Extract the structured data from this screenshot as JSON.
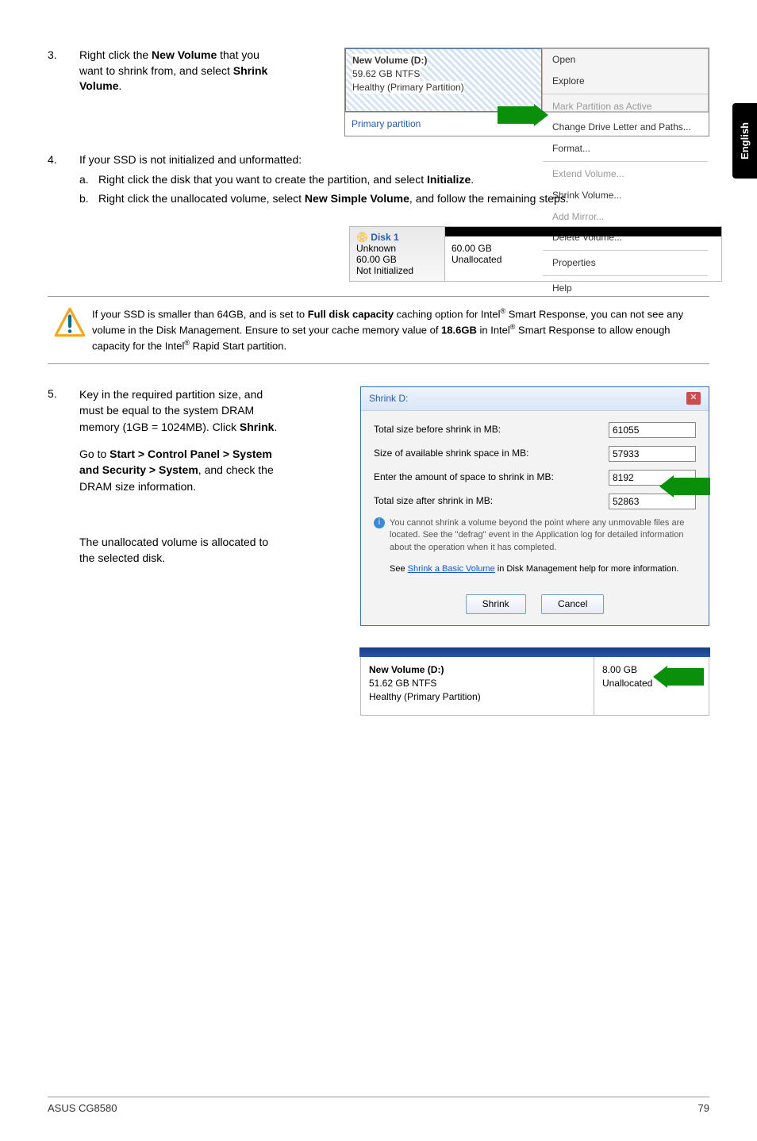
{
  "sidetab": "English",
  "step3": {
    "num": "3.",
    "t1": "Right click the ",
    "b1": "New Volume",
    "t2": " that you want to shrink from, and select ",
    "b2": "Shrink Volume",
    "t3": "."
  },
  "ctx": {
    "vol_title": "New Volume  (D:)",
    "vol_size": "59.62 GB NTFS",
    "vol_health": "Healthy (Primary Partition)",
    "primary": "Primary partition",
    "items": [
      "Open",
      "Explore",
      "Mark Partition as Active",
      "Change Drive Letter and Paths...",
      "Format...",
      "Extend Volume...",
      "Shrink Volume...",
      "Add Mirror...",
      "Delete Volume...",
      "Properties",
      "Help"
    ]
  },
  "step4": {
    "num": "4.",
    "lead": "If your SSD is not initialized and unformatted:",
    "a": {
      "l": "a.",
      "t1": "Right click the disk that you want to create the partition, and select ",
      "b": "Initialize",
      "t2": "."
    },
    "b": {
      "l": "b.",
      "t1": "Right click the unallocated volume, select ",
      "bld": "New Simple Volume",
      "t2": ", and follow the remaining steps."
    }
  },
  "disk": {
    "icon": "Disk 1",
    "l1": "Unknown",
    "l2": "60.00 GB",
    "l3": "Not Initialized",
    "r1": "60.00 GB",
    "r2": "Unallocated"
  },
  "note": {
    "t1": "If your SSD is smaller than 64GB, and is set to ",
    "b1": "Full disk capacity",
    "t2": " caching option for Intel",
    "t3": " Smart Response, you can not see any volume in the Disk Management. Ensure to set your cache memory value of ",
    "b2": "18.6GB",
    "t4": " in Intel",
    "t5": " Smart Response to allow enough capacity for the Intel",
    "t6": " Rapid Start partition."
  },
  "step5": {
    "num": "5.",
    "t1": "Key in the required partition size, and must be equal to the system DRAM memory (1GB = 1024MB). Click ",
    "b1": "Shrink",
    "t2": ".",
    "p2a": "Go to ",
    "p2b": "Start > Control Panel > System and Security > System",
    "p2c": ", and check the DRAM size information.",
    "p3": "The unallocated volume is allocated to the selected disk."
  },
  "dlg": {
    "title": "Shrink D:",
    "r1": "Total size before shrink in MB:",
    "v1": "61055",
    "r2": "Size of available shrink space in MB:",
    "v2": "57933",
    "r3": "Enter the amount of space to shrink in MB:",
    "v3": "8192",
    "r4": "Total size after shrink in MB:",
    "v4": "52863",
    "note": "You cannot shrink a volume beyond the point where any unmovable files are located. See the \"defrag\" event in the Application log for detailed information about the operation when it has completed.",
    "link_pre": "See ",
    "link": "Shrink a Basic Volume",
    "link_post": " in Disk Management help for more information.",
    "btn1": "Shrink",
    "btn2": "Cancel"
  },
  "result": {
    "l1": "New Volume  (D:)",
    "l2": "51.62 GB NTFS",
    "l3": "Healthy (Primary Partition)",
    "r1": "8.00 GB",
    "r2": "Unallocated"
  },
  "footer": {
    "left": "ASUS CG8580",
    "right": "79"
  }
}
